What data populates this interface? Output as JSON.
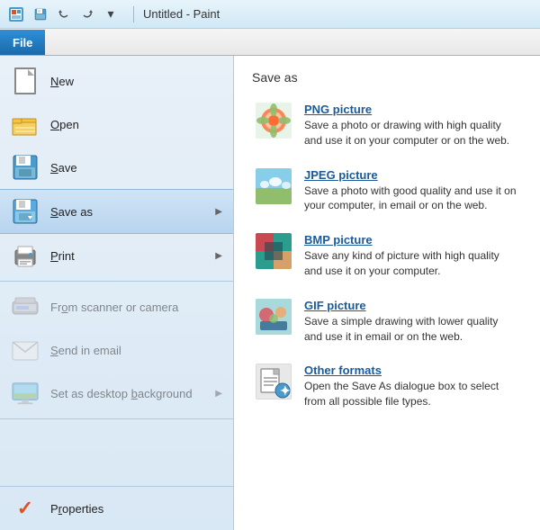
{
  "titlebar": {
    "title": "Untitled - Paint",
    "undo_label": "Undo",
    "redo_label": "Redo",
    "save_quick_label": "Save"
  },
  "ribbon": {
    "file_tab": "File"
  },
  "left_menu": {
    "items": [
      {
        "id": "new",
        "label": "New",
        "underline_index": 0,
        "has_arrow": false,
        "disabled": false,
        "icon": "new-doc"
      },
      {
        "id": "open",
        "label": "Open",
        "underline_index": 0,
        "has_arrow": false,
        "disabled": false,
        "icon": "folder"
      },
      {
        "id": "save",
        "label": "Save",
        "underline_index": 0,
        "has_arrow": false,
        "disabled": false,
        "icon": "disk"
      },
      {
        "id": "saveas",
        "label": "Save as",
        "underline_index": 0,
        "has_arrow": true,
        "disabled": false,
        "active": true,
        "icon": "saveas-disk"
      },
      {
        "id": "print",
        "label": "Print",
        "underline_index": 0,
        "has_arrow": true,
        "disabled": false,
        "icon": "print"
      },
      {
        "id": "scanner",
        "label": "From scanner or camera",
        "underline_index": 5,
        "has_arrow": false,
        "disabled": true,
        "icon": "scanner"
      },
      {
        "id": "email",
        "label": "Send in email",
        "underline_index": 0,
        "has_arrow": false,
        "disabled": true,
        "icon": "email"
      },
      {
        "id": "desktop",
        "label": "Set as desktop background",
        "underline_index": 7,
        "has_arrow": true,
        "disabled": true,
        "icon": "desktop"
      },
      {
        "id": "properties",
        "label": "Properties",
        "underline_index": 0,
        "has_arrow": false,
        "disabled": false,
        "icon": "checkmark"
      }
    ]
  },
  "saveas_panel": {
    "title": "Save as",
    "items": [
      {
        "id": "png",
        "title": "PNG picture",
        "description": "Save a photo or drawing with high quality and use it on your computer or on the web.",
        "icon": "png"
      },
      {
        "id": "jpeg",
        "title": "JPEG picture",
        "description": "Save a photo with good quality and use it on your computer, in email or on the web.",
        "icon": "jpeg"
      },
      {
        "id": "bmp",
        "title": "BMP picture",
        "description": "Save any kind of picture with high quality and use it on your computer.",
        "icon": "bmp"
      },
      {
        "id": "gif",
        "title": "GIF picture",
        "description": "Save a simple drawing with lower quality and use it in email or on the web.",
        "icon": "gif"
      },
      {
        "id": "other",
        "title": "Other formats",
        "description": "Open the Save As dialogue box to select from all possible file types.",
        "icon": "other"
      }
    ]
  }
}
